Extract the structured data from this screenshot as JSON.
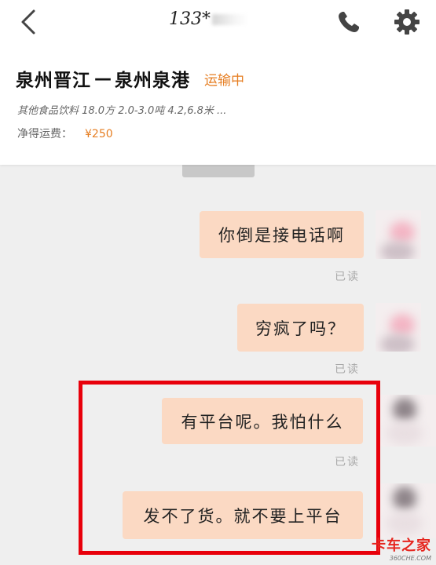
{
  "header": {
    "contact_name": "133*",
    "route": {
      "origin": "泉州晋江",
      "arrow": "—",
      "destination": "泉州泉港",
      "status": "运输中"
    },
    "cargo_info": "其他食品饮料 18.0方 2.0-3.0吨 4.2,6.8米 ...",
    "fee_label": "净得运费：",
    "fee_amount": "¥250"
  },
  "chat": {
    "messages": [
      {
        "text": "你倒是接电话啊",
        "read_status": "已读"
      },
      {
        "text": "穷疯了吗？",
        "read_status": "已读"
      },
      {
        "text": "有平台呢。我怕什么",
        "read_status": "已读"
      },
      {
        "text": "发不了货。就不要上平台",
        "read_status": ""
      }
    ]
  },
  "watermark": {
    "brand": "卡车之家",
    "site": "360CHE.COM"
  },
  "colors": {
    "accent_orange": "#e67e22",
    "bubble": "#fbd9c3",
    "highlight_red": "#e8000b",
    "chat_bg": "#efefef"
  },
  "icons": [
    "back-arrow-icon",
    "phone-icon",
    "gear-icon"
  ]
}
